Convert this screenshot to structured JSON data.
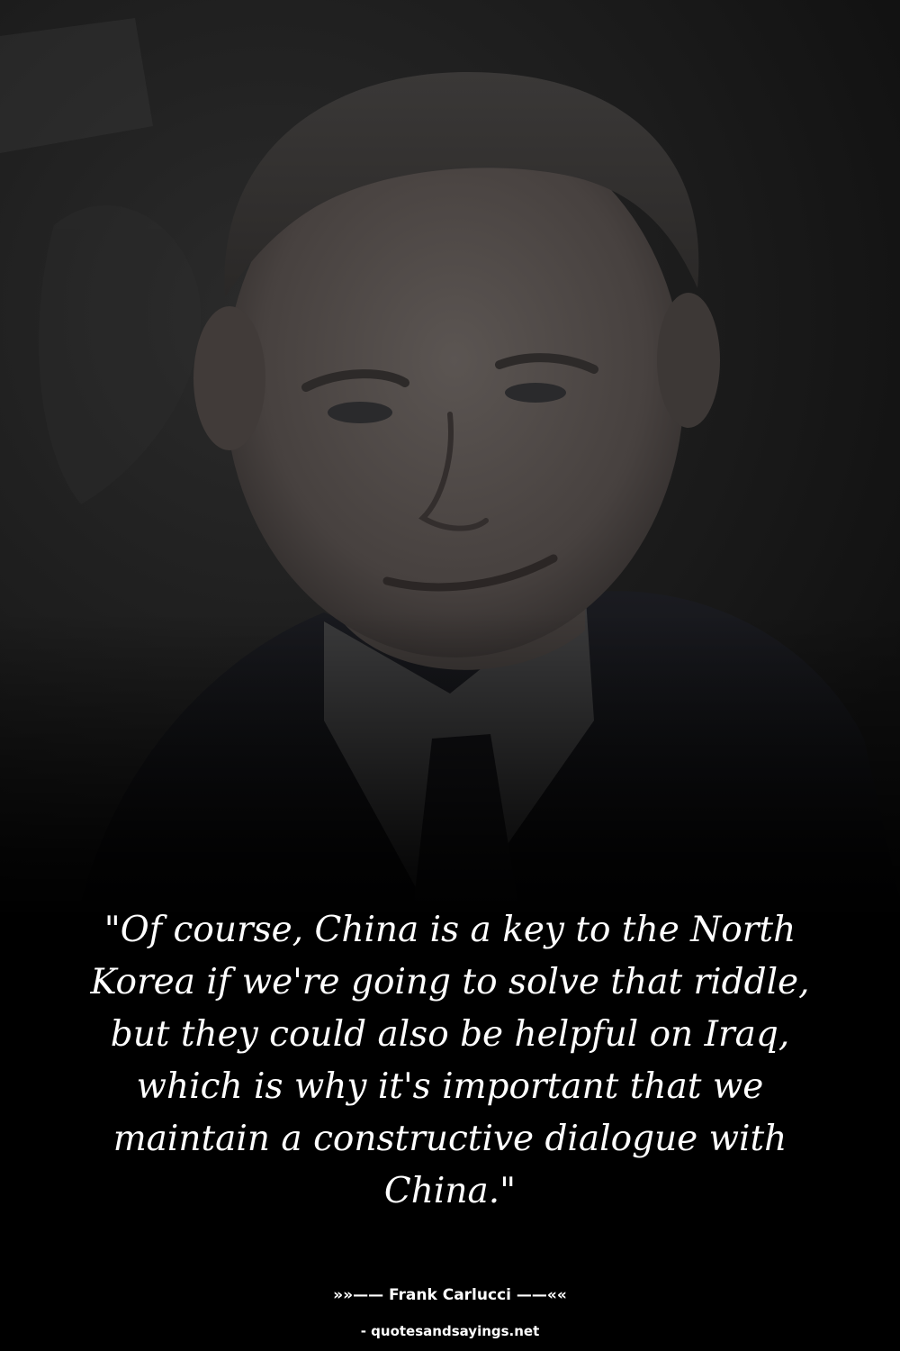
{
  "image": {
    "description_icon": "portrait-photo"
  },
  "quote": {
    "text": "\"Of course, China is a key to the North Korea if we're going to solve that riddle, but they could also be helpful on Iraq, which is why it's important that we maintain a constructive dialogue with China.\""
  },
  "attribution": {
    "author_line": "»»—— Frank Carlucci ——««",
    "source_line": "- quotesandsayings.net"
  },
  "colors": {
    "background": "#000000",
    "text": "#ffffff"
  }
}
